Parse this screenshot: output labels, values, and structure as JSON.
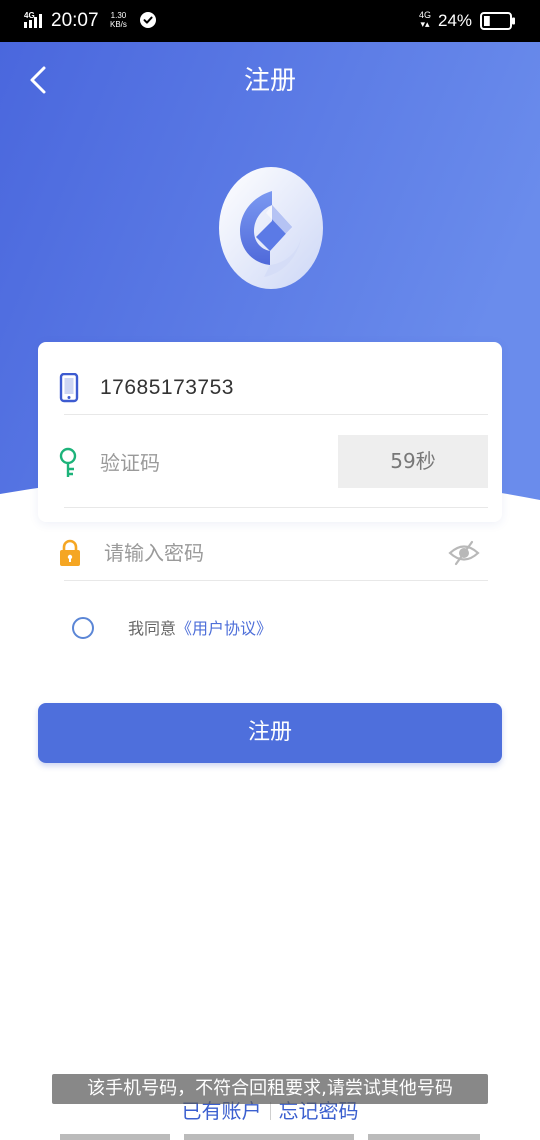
{
  "status_bar": {
    "network": "4G",
    "time": "20:07",
    "speed_value": "1.30",
    "speed_unit": "KB/s",
    "network_right": "4G",
    "battery_percent": "24%",
    "battery_level": 0.24
  },
  "header": {
    "title": "注册",
    "back_icon": "chevron-left-icon",
    "logo_icon": "app-logo"
  },
  "form": {
    "phone": {
      "icon": "phone-icon",
      "value": "17685173753"
    },
    "code": {
      "icon": "key-icon",
      "placeholder": "验证码",
      "button_label": "59秒"
    },
    "password": {
      "icon": "lock-icon",
      "placeholder": "请输入密码",
      "toggle_icon": "eye-hidden-icon"
    },
    "agreement": {
      "text": "我同意",
      "link": "《用户协议》",
      "checked": false
    }
  },
  "register_button": {
    "label": "注册"
  },
  "footer": {
    "have_account": "已有账户",
    "forgot_password": "忘记密码"
  },
  "toast": {
    "message": "该手机号码，不符合回租要求,请尝试其他号码"
  },
  "colors": {
    "primary": "#4e6fdc",
    "header_gradient_start": "#4a67dd",
    "header_gradient_end": "#6a8cec",
    "key_icon": "#1db37a",
    "lock_icon": "#f5a623",
    "phone_icon": "#3d5bd0"
  }
}
